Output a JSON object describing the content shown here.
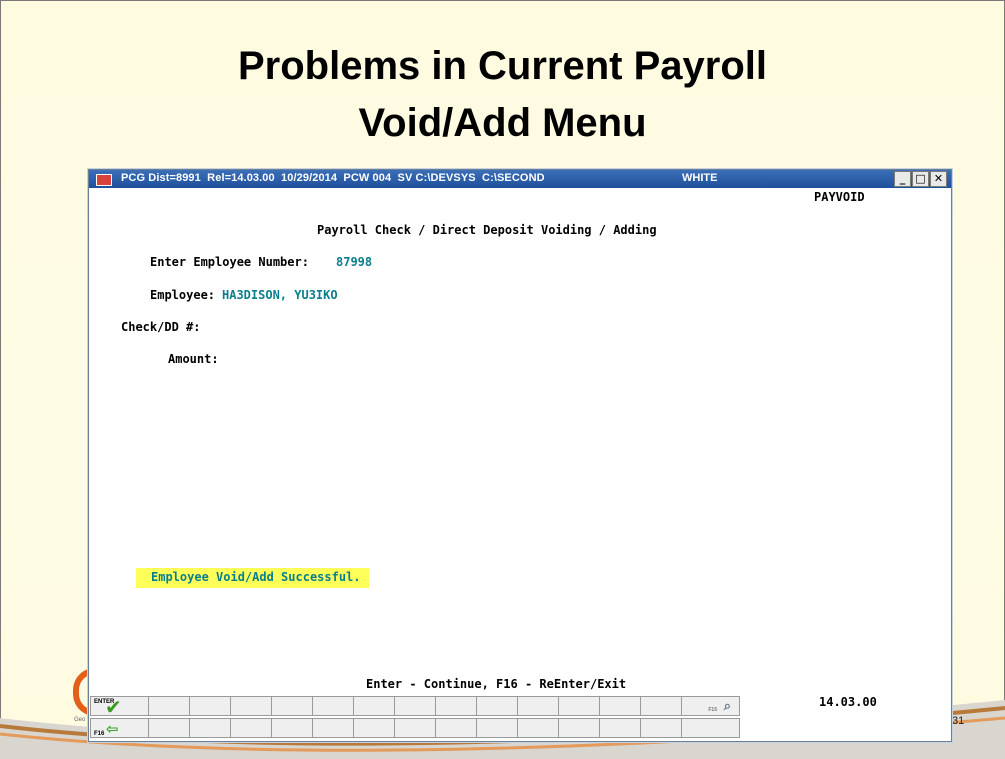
{
  "slide": {
    "title_line1": "Problems in Current Payroll",
    "title_line2": "Void/Add Menu",
    "slide_number": "31",
    "logo_text": "Geo"
  },
  "window": {
    "title": "PCG Dist=8991  Rel=14.03.00  10/29/2014  PCW 004  SV C:\\DEVSYS  C:\\SECOND",
    "user": "WHITE",
    "minimize_glyph": "_",
    "maximize_glyph": "□",
    "close_glyph": "✕"
  },
  "screen": {
    "id": "PAYVOID",
    "heading": "Payroll Check / Direct Deposit Voiding / Adding",
    "employee_number_label": "Enter Employee Number:",
    "employee_number_value": "87998",
    "employee_label": "Employee:",
    "employee_value": "HA3DISON, YU3IKO",
    "check_dd_label": "Check/DD #:",
    "amount_label": "Amount:",
    "status_message": "Employee Void/Add Successful.",
    "footer_hint": "Enter - Continue,  F16 - ReEnter/Exit",
    "version": "14.03.00"
  },
  "fkeys": {
    "enter_label": "ENTER",
    "f16_label": "F16",
    "f15_label": "F15",
    "enter_icon": "check-icon",
    "f16_icon": "back-arrow-icon",
    "f15_icon": "search-icon"
  },
  "colors": {
    "field_value": "#0a7f8c",
    "status_highlight": "#ffff5a",
    "titlebar": "#2a5ea8"
  }
}
